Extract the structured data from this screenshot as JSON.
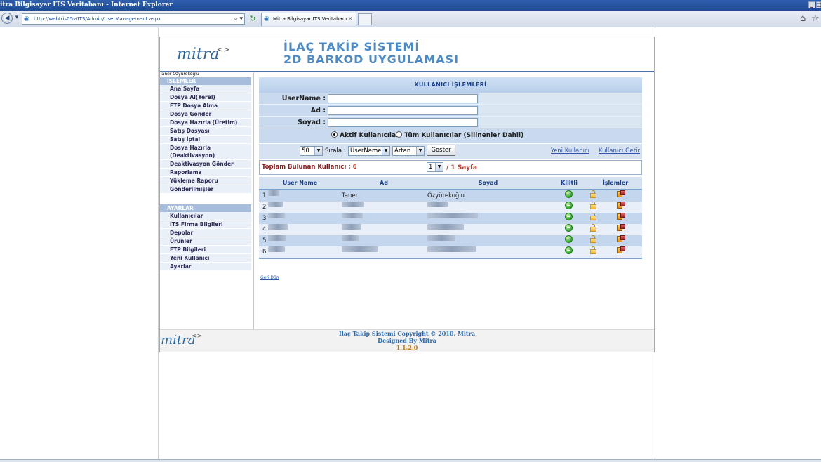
{
  "window": {
    "title": "itra Bilgisayar ITS Veritabanı - Internet Explorer"
  },
  "browser": {
    "url": "http://webtris05v/ITS/Admin/UserManagement.aspx",
    "tab_title": "Mitra Bilgisayar ITS Veritabanı",
    "icons": [
      "back-icon",
      "forward-icon",
      "search-icon",
      "refresh-icon",
      "close-icon",
      "home-icon",
      "star-icon"
    ]
  },
  "header": {
    "logo": "mitra",
    "logo_mark": "<>",
    "title_line1": "İLAÇ TAKİP SİSTEMİ",
    "title_line2": "2D BARKOD UYGULAMASI"
  },
  "current_user": "Taner Özyürekoğlu",
  "sidebar": {
    "section1": {
      "title": "İŞLEMLER",
      "items": [
        "Ana Sayfa",
        "Dosya Al(Yerel)",
        "FTP Dosya Alma",
        "Dosya Gönder",
        "Dosya Hazırla (Üretim)",
        "Satış Dosyası",
        "Satış İptal",
        "Dosya Hazırla (Deaktivasyon)",
        "Deaktivasyon Gönder",
        "Raporlama",
        "Yükleme Raporu",
        "Gönderilmişler"
      ]
    },
    "section2": {
      "title": "AYARLAR",
      "items": [
        "Kullanıcılar",
        "ITS Firma Bilgileri",
        "Depolar",
        "Ürünler",
        "FTP Bilgileri",
        "Yeni Kullanıcı",
        "Ayarlar"
      ]
    }
  },
  "panel": {
    "title": "KULLANICI İŞLEMLERİ",
    "form": {
      "username_label": "UserName :",
      "username_value": "",
      "ad_label": "Ad :",
      "ad_value": "",
      "soyad_label": "Soyad :",
      "soyad_value": ""
    },
    "radio": {
      "active_label": "Aktif Kullanıcılar",
      "all_label": "Tüm Kullanıcılar (Silinenler Dahil)",
      "selected": "active"
    },
    "controls": {
      "page_size": "50",
      "sort_label": "Sırala :",
      "sort_field": "UserName",
      "sort_dir": "Artan",
      "show_button": "Göster",
      "new_user_link": "Yeni Kullanıcı",
      "fetch_user_link": "Kullanıcı Getir"
    },
    "summary": {
      "label": "Toplam Bulunan Kullanıcı :",
      "count": "6",
      "page": "1",
      "page_total": "/ 1 Sayfa"
    },
    "table": {
      "headers": {
        "username": "User Name",
        "ad": "Ad",
        "soyad": "Soyad",
        "kilitli": "Kilitli",
        "islemler": "İşlemler"
      },
      "rows": [
        {
          "no": "1",
          "username": "",
          "ad": "Taner",
          "soyad": "Özyürekoğlu"
        },
        {
          "no": "2",
          "username": "",
          "ad": "",
          "soyad": ""
        },
        {
          "no": "3",
          "username": "",
          "ad": "",
          "soyad": ""
        },
        {
          "no": "4",
          "username": "",
          "ad": "",
          "soyad": ""
        },
        {
          "no": "5",
          "username": "",
          "ad": "",
          "soyad": ""
        },
        {
          "no": "6",
          "username": "",
          "ad": "",
          "soyad": ""
        }
      ]
    },
    "back_link": "Geri Dön"
  },
  "footer": {
    "logo": "mitra",
    "logo_mark": "<>",
    "line1": "Ilaç Takip Sistemi   Copyright © 2010, Mitra",
    "line2": "Designed By  Mitra",
    "version": "1.1.2.0"
  },
  "colors": {
    "accent": "#4a8ac8",
    "header_bar": "#a6bedb",
    "row_odd": "#c4d6ee",
    "row_even": "#e8eff8",
    "count_red": "#c0392b"
  }
}
